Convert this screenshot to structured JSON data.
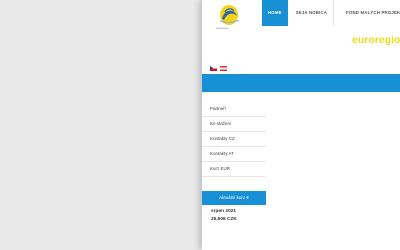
{
  "logo": {
    "text": "euroregio",
    "icon": "bird-logo-icon"
  },
  "nav": {
    "items": [
      {
        "label": "HOME",
        "active": true
      },
      {
        "label": "SEJA NOBICA",
        "active": false
      },
      {
        "label": "FOND MALÝCH PROJEKTŮ",
        "active": false
      }
    ]
  },
  "brand": {
    "text": "euroregio"
  },
  "languages": [
    "cz-flag-icon",
    "at-flag-icon"
  ],
  "sidebar": {
    "items": [
      {
        "label": "Partneři"
      },
      {
        "label": "Ke stažení"
      },
      {
        "label": "Kontakty CZ"
      },
      {
        "label": "Kontakty AT"
      },
      {
        "label": "Kurz EUR"
      }
    ]
  },
  "widget": {
    "title": "Aktuální kurz €",
    "date": "srpen 2021",
    "rate": "25,506 CZK"
  },
  "colors": {
    "accent": "#1790d5",
    "brand_yellow": "#e8dc1a",
    "background": "#e9e9ea"
  }
}
